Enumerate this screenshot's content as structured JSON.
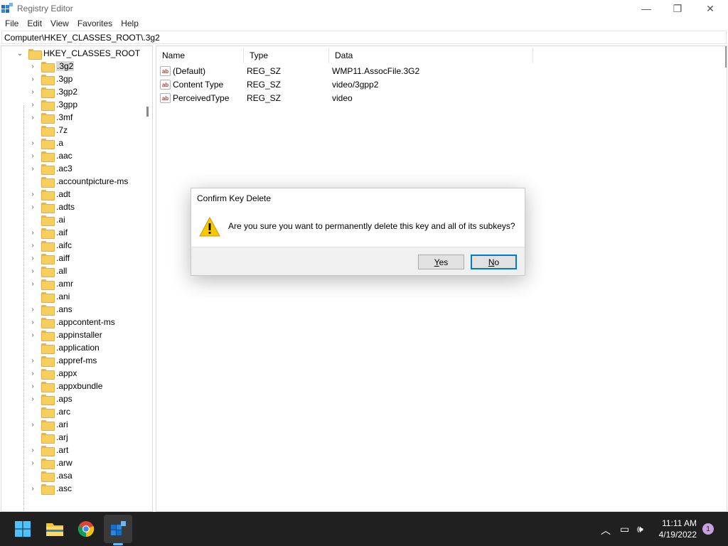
{
  "window": {
    "title": "Registry Editor",
    "minimize": "—",
    "maximize": "❐",
    "close": "✕"
  },
  "menu": [
    "File",
    "Edit",
    "View",
    "Favorites",
    "Help"
  ],
  "address": "Computer\\HKEY_CLASSES_ROOT\\.3g2",
  "tree": {
    "root": "HKEY_CLASSES_ROOT",
    "items": [
      {
        "label": ".3g2",
        "expandable": true,
        "selected": true
      },
      {
        "label": ".3gp",
        "expandable": true
      },
      {
        "label": ".3gp2",
        "expandable": true
      },
      {
        "label": ".3gpp",
        "expandable": true
      },
      {
        "label": ".3mf",
        "expandable": true
      },
      {
        "label": ".7z",
        "expandable": false
      },
      {
        "label": ".a",
        "expandable": true
      },
      {
        "label": ".aac",
        "expandable": true
      },
      {
        "label": ".ac3",
        "expandable": true
      },
      {
        "label": ".accountpicture-ms",
        "expandable": false
      },
      {
        "label": ".adt",
        "expandable": true
      },
      {
        "label": ".adts",
        "expandable": true
      },
      {
        "label": ".ai",
        "expandable": false
      },
      {
        "label": ".aif",
        "expandable": true
      },
      {
        "label": ".aifc",
        "expandable": true
      },
      {
        "label": ".aiff",
        "expandable": true
      },
      {
        "label": ".all",
        "expandable": true
      },
      {
        "label": ".amr",
        "expandable": true
      },
      {
        "label": ".ani",
        "expandable": false
      },
      {
        "label": ".ans",
        "expandable": true
      },
      {
        "label": ".appcontent-ms",
        "expandable": true
      },
      {
        "label": ".appinstaller",
        "expandable": true
      },
      {
        "label": ".application",
        "expandable": false
      },
      {
        "label": ".appref-ms",
        "expandable": true
      },
      {
        "label": ".appx",
        "expandable": true
      },
      {
        "label": ".appxbundle",
        "expandable": true
      },
      {
        "label": ".aps",
        "expandable": true
      },
      {
        "label": ".arc",
        "expandable": false
      },
      {
        "label": ".ari",
        "expandable": true
      },
      {
        "label": ".arj",
        "expandable": false
      },
      {
        "label": ".art",
        "expandable": true
      },
      {
        "label": ".arw",
        "expandable": true
      },
      {
        "label": ".asa",
        "expandable": false
      },
      {
        "label": ".asc",
        "expandable": true
      }
    ]
  },
  "list": {
    "columns": [
      "Name",
      "Type",
      "Data"
    ],
    "rows": [
      {
        "name": "(Default)",
        "type": "REG_SZ",
        "data": "WMP11.AssocFile.3G2"
      },
      {
        "name": "Content Type",
        "type": "REG_SZ",
        "data": "video/3gpp2"
      },
      {
        "name": "PerceivedType",
        "type": "REG_SZ",
        "data": "video"
      }
    ]
  },
  "dialog": {
    "title": "Confirm Key Delete",
    "message": "Are you sure you want to permanently delete this key and all of its subkeys?",
    "yes": "Yes",
    "no": "No"
  },
  "taskbar": {
    "time": "11:11 AM",
    "date": "4/19/2022",
    "notifications": "1"
  }
}
